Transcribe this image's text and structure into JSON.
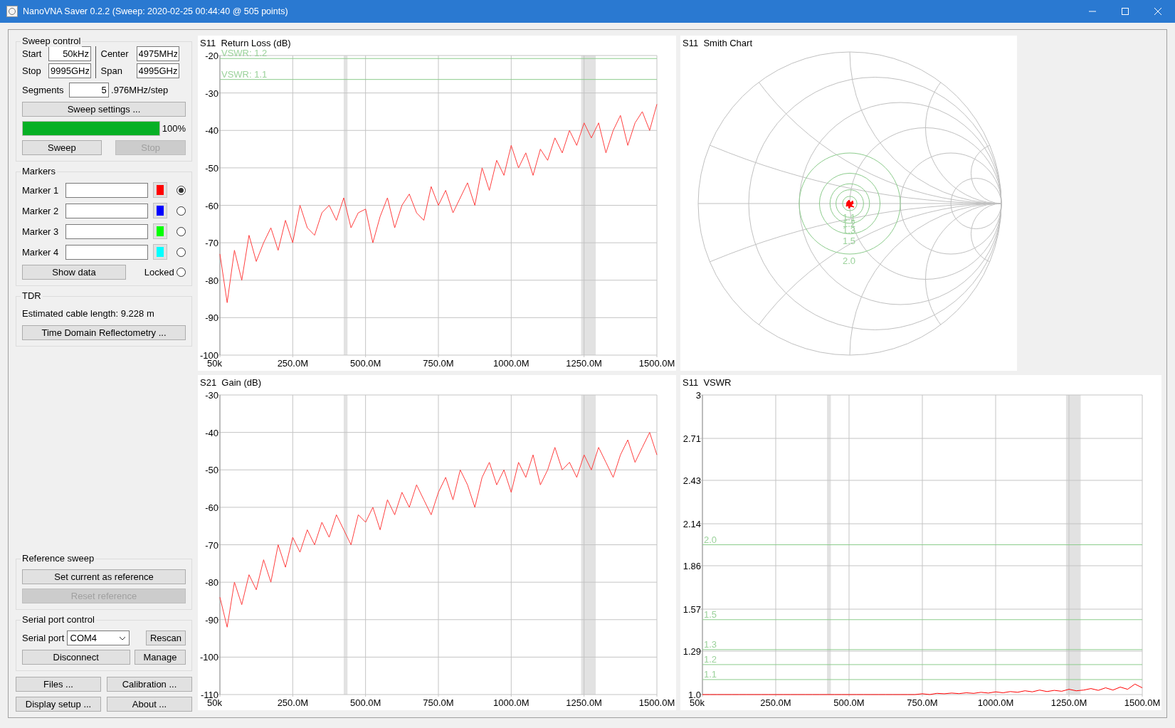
{
  "window": {
    "title": "NanoVNA Saver 0.2.2 (Sweep: 2020-02-25 00:44:40 @ 505 points)"
  },
  "sweep_control": {
    "title": "Sweep control",
    "fields": [
      {
        "label": "Start",
        "value": "50kHz"
      },
      {
        "label": "Center",
        "value": "4975MHz"
      },
      {
        "label": "Stop",
        "value": "9995GHz"
      },
      {
        "label": "Span",
        "value": "4995GHz"
      }
    ],
    "segments": {
      "label": "Segments",
      "value": "5",
      "step": ".976MHz/step"
    },
    "settings_button": "Sweep settings ...",
    "progress": {
      "level": 1.0,
      "reading": "100%"
    },
    "buttons": [
      {
        "label": "Sweep",
        "disabled": false
      },
      {
        "label": "Stop",
        "disabled": true
      }
    ]
  },
  "markers": {
    "title": "Markers",
    "items": [
      {
        "label": "Marker 1",
        "color": "#ff0000",
        "selected": true
      },
      {
        "label": "Marker 2",
        "color": "#0000ff",
        "selected": false
      },
      {
        "label": "Marker 3",
        "color": "#00ff00",
        "selected": false
      },
      {
        "label": "Marker 4",
        "color": "#00ffff",
        "selected": false
      }
    ],
    "show_data": "Show data",
    "locked": {
      "label": "Locked",
      "checked": false
    }
  },
  "tdr": {
    "title": "TDR",
    "cable_length": "Estimated cable length: 9.228 m",
    "button": "Time Domain Reflectometry ..."
  },
  "reference_sweep": {
    "title": "Reference sweep",
    "buttons": [
      {
        "label": "Set current as reference",
        "disabled": false
      },
      {
        "label": "Reset reference",
        "disabled": true
      }
    ]
  },
  "serial_port": {
    "title": "Serial port control",
    "label": "Serial port",
    "port": "COM4",
    "rescan": "Rescan",
    "disconnect": "Disconnect",
    "manage": "Manage"
  },
  "bottom_buttons": [
    "Files ...",
    "Calibration ...",
    "Display setup ...",
    "About ..."
  ],
  "charts": [
    {
      "kind": "line",
      "chart_data": {
        "type": "line",
        "title": "S11  Return Loss (dB)",
        "grid": true,
        "xlim": [
          50000,
          1500000000
        ],
        "ylim": [
          -100,
          -20
        ],
        "xticks": [
          {
            "value": 50000,
            "label": "50k"
          },
          {
            "value": 250000000,
            "label": "250.0M"
          },
          {
            "value": 500000000,
            "label": "500.0M"
          },
          {
            "value": 750000000,
            "label": "750.0M"
          },
          {
            "value": 1000000000,
            "label": "1000.0M"
          },
          {
            "value": 1250000000,
            "label": "1250.0M"
          },
          {
            "value": 1500000000,
            "label": "1500.0M"
          }
        ],
        "yticks": [
          -20,
          -30,
          -40,
          -50,
          -60,
          -70,
          -80,
          -90,
          -100
        ],
        "x": [
          50000,
          25000000,
          50000000,
          75000000,
          100000000,
          125000000,
          150000000,
          175000000,
          200000000,
          225000000,
          250000000,
          275000000,
          300000000,
          325000000,
          350000000,
          375000000,
          400000000,
          425000000,
          450000000,
          475000000,
          500000000,
          525000000,
          550000000,
          575000000,
          600000000,
          625000000,
          650000000,
          675000000,
          700000000,
          725000000,
          750000000,
          775000000,
          800000000,
          825000000,
          850000000,
          875000000,
          900000000,
          925000000,
          950000000,
          975000000,
          1000000000,
          1025000000,
          1050000000,
          1075000000,
          1100000000,
          1125000000,
          1150000000,
          1175000000,
          1200000000,
          1225000000,
          1250000000,
          1275000000,
          1300000000,
          1325000000,
          1350000000,
          1375000000,
          1400000000,
          1425000000,
          1450000000,
          1475000000,
          1500000000
        ],
        "series": [
          {
            "color": "#ff4040",
            "values": [
              -73,
              -86,
              -72,
              -80,
              -68,
              -75,
              -70,
              -66,
              -72,
              -64,
              -70,
              -60,
              -66,
              -68,
              -62,
              -60,
              -64,
              -58,
              -66,
              -62,
              -61,
              -70,
              -63,
              -58,
              -66,
              -60,
              -57,
              -62,
              -64,
              -55,
              -60,
              -56,
              -62,
              -58,
              -54,
              -60,
              -50,
              -56,
              -48,
              -52,
              -44,
              -50,
              -46,
              -52,
              -45,
              -48,
              -42,
              -46,
              -40,
              -44,
              -38,
              -42,
              -38,
              -46,
              -40,
              -36,
              -44,
              -38,
              -35,
              -40,
              -33
            ]
          }
        ],
        "bands": [
          {
            "axis": "x",
            "from": 425000000,
            "to": 438000000
          },
          {
            "axis": "x",
            "from": 1240000000,
            "to": 1290000000
          }
        ],
        "ref_lines": [
          {
            "axis": "y",
            "value": -20.8
          },
          {
            "axis": "y",
            "value": -26.4
          }
        ],
        "annotations": [
          "VSWR: 1.2",
          "VSWR: 1.1"
        ]
      }
    },
    {
      "kind": "smith",
      "title": "S11  Smith Chart",
      "vswr_labels": [
        "1.1",
        "1.2",
        "1.3",
        "1.5",
        "2.0"
      ]
    },
    {
      "kind": "line",
      "chart_data": {
        "type": "line",
        "title": "S21  Gain (dB)",
        "grid": true,
        "xlim": [
          50000,
          1500000000
        ],
        "ylim": [
          -110,
          -30
        ],
        "xticks": [
          {
            "value": 50000,
            "label": "50k"
          },
          {
            "value": 250000000,
            "label": "250.0M"
          },
          {
            "value": 500000000,
            "label": "500.0M"
          },
          {
            "value": 750000000,
            "label": "750.0M"
          },
          {
            "value": 1000000000,
            "label": "1000.0M"
          },
          {
            "value": 1250000000,
            "label": "1250.0M"
          },
          {
            "value": 1500000000,
            "label": "1500.0M"
          }
        ],
        "yticks": [
          -30,
          -40,
          -50,
          -60,
          -70,
          -80,
          -90,
          -100,
          -110
        ],
        "x": [
          50000,
          25000000,
          50000000,
          75000000,
          100000000,
          125000000,
          150000000,
          175000000,
          200000000,
          225000000,
          250000000,
          275000000,
          300000000,
          325000000,
          350000000,
          375000000,
          400000000,
          425000000,
          450000000,
          475000000,
          500000000,
          525000000,
          550000000,
          575000000,
          600000000,
          625000000,
          650000000,
          675000000,
          700000000,
          725000000,
          750000000,
          775000000,
          800000000,
          825000000,
          850000000,
          875000000,
          900000000,
          925000000,
          950000000,
          975000000,
          1000000000,
          1025000000,
          1050000000,
          1075000000,
          1100000000,
          1125000000,
          1150000000,
          1175000000,
          1200000000,
          1225000000,
          1250000000,
          1275000000,
          1300000000,
          1325000000,
          1350000000,
          1375000000,
          1400000000,
          1425000000,
          1450000000,
          1475000000,
          1500000000
        ],
        "series": [
          {
            "color": "#ff4040",
            "values": [
              -84,
              -92,
              -80,
              -86,
              -78,
              -82,
              -74,
              -80,
              -70,
              -76,
              -68,
              -72,
              -66,
              -70,
              -64,
              -68,
              -62,
              -66,
              -70,
              -62,
              -64,
              -60,
              -66,
              -58,
              -62,
              -56,
              -60,
              -54,
              -58,
              -62,
              -56,
              -52,
              -58,
              -50,
              -54,
              -60,
              -52,
              -48,
              -54,
              -50,
              -56,
              -48,
              -52,
              -46,
              -54,
              -50,
              -44,
              -50,
              -48,
              -52,
              -46,
              -50,
              -44,
              -48,
              -52,
              -46,
              -42,
              -48,
              -44,
              -40,
              -46
            ]
          }
        ],
        "bands": [
          {
            "axis": "x",
            "from": 425000000,
            "to": 438000000
          },
          {
            "axis": "x",
            "from": 1240000000,
            "to": 1290000000
          }
        ]
      }
    },
    {
      "kind": "line",
      "chart_data": {
        "type": "line",
        "title": "S11  VSWR",
        "grid": true,
        "xlim": [
          50000,
          1500000000
        ],
        "ylim": [
          1.0,
          3
        ],
        "xticks": [
          {
            "value": 50000,
            "label": "50k"
          },
          {
            "value": 250000000,
            "label": "250.0M"
          },
          {
            "value": 500000000,
            "label": "500.0M"
          },
          {
            "value": 750000000,
            "label": "750.0M"
          },
          {
            "value": 1000000000,
            "label": "1000.0M"
          },
          {
            "value": 1250000000,
            "label": "1250.0M"
          },
          {
            "value": 1500000000,
            "label": "1500.0M"
          }
        ],
        "yticks": [
          {
            "value": 3,
            "label": "3"
          },
          {
            "value": 2.71,
            "label": "2.71"
          },
          {
            "value": 2.43,
            "label": "2.43"
          },
          {
            "value": 2.14,
            "label": "2.14"
          },
          {
            "value": 1.86,
            "label": "1.86"
          },
          {
            "value": 1.57,
            "label": "1.57"
          },
          {
            "value": 1.29,
            "label": "1.29"
          },
          {
            "value": 1.0,
            "label": "1.0"
          }
        ],
        "x": [
          50000,
          25000000,
          50000000,
          75000000,
          100000000,
          125000000,
          150000000,
          175000000,
          200000000,
          225000000,
          250000000,
          275000000,
          300000000,
          325000000,
          350000000,
          375000000,
          400000000,
          425000000,
          450000000,
          475000000,
          500000000,
          525000000,
          550000000,
          575000000,
          600000000,
          625000000,
          650000000,
          675000000,
          700000000,
          725000000,
          750000000,
          775000000,
          800000000,
          825000000,
          850000000,
          875000000,
          900000000,
          925000000,
          950000000,
          975000000,
          1000000000,
          1025000000,
          1050000000,
          1075000000,
          1100000000,
          1125000000,
          1150000000,
          1175000000,
          1200000000,
          1225000000,
          1250000000,
          1275000000,
          1300000000,
          1325000000,
          1350000000,
          1375000000,
          1400000000,
          1425000000,
          1450000000,
          1475000000,
          1500000000
        ],
        "series": [
          {
            "color": "#ff0000",
            "values": [
              1.0,
              1.0,
              1.0,
              1.0,
              1.0,
              1.0,
              1.0,
              1.0,
              1.0,
              1.0,
              1.0,
              1.0,
              1.0,
              1.0,
              1.0,
              1.0,
              1.0,
              1.0,
              1.0,
              1.0,
              1.0,
              1.0,
              1.0,
              1.0,
              1.0,
              1.0,
              1.0,
              1.0,
              1.0,
              1.0,
              1.005,
              1.0,
              1.008,
              1.005,
              1.01,
              1.006,
              1.012,
              1.008,
              1.015,
              1.01,
              1.018,
              1.012,
              1.02,
              1.015,
              1.025,
              1.018,
              1.03,
              1.02,
              1.028,
              1.022,
              1.035,
              1.025,
              1.03,
              1.04,
              1.028,
              1.045,
              1.03,
              1.05,
              1.035,
              1.07,
              1.045
            ]
          }
        ],
        "bands": [
          {
            "axis": "x",
            "from": 425000000,
            "to": 438000000
          },
          {
            "axis": "x",
            "from": 1240000000,
            "to": 1290000000
          }
        ],
        "ref_lines": [
          {
            "axis": "y",
            "value": 2.0,
            "label": "2.0"
          },
          {
            "axis": "y",
            "value": 1.5,
            "label": "1.5"
          },
          {
            "axis": "y",
            "value": 1.3,
            "label": "1.3"
          },
          {
            "axis": "y",
            "value": 1.2,
            "label": "1.2"
          },
          {
            "axis": "y",
            "value": 1.1,
            "label": "1.1"
          }
        ]
      }
    }
  ]
}
